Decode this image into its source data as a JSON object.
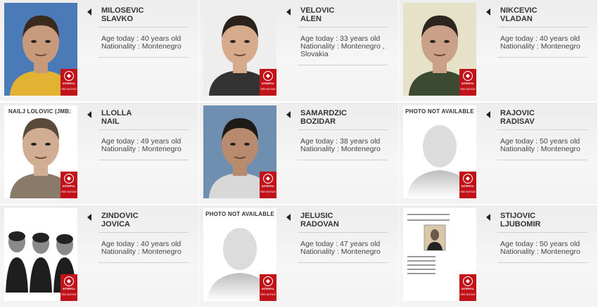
{
  "age_prefix": "Age today : ",
  "nationality_prefix": "Nationality : ",
  "notice_badge": {
    "brand": "INTERPOL",
    "kind": "RED NOTICE",
    "color": "#c1121a"
  },
  "placeholder_caption": "PHOTO NOT AVAILABLE",
  "persons": [
    {
      "surname": "MILOSEVIC",
      "forename": "SLAVKO",
      "age": "40 years old",
      "nationality": "Montenegro",
      "photo": "photo",
      "photo_text": ""
    },
    {
      "surname": "VELOVIC",
      "forename": "ALEN",
      "age": "33 years old",
      "nationality": "Montenegro , Slovakia",
      "photo": "photo",
      "photo_text": ""
    },
    {
      "surname": "NIKCEVIC",
      "forename": "VLADAN",
      "age": "40 years old",
      "nationality": "Montenegro",
      "photo": "photo",
      "photo_text": ""
    },
    {
      "surname": "LLOLLA",
      "forename": "NAIL",
      "age": "49 years old",
      "nationality": "Montenegro",
      "photo": "photo",
      "photo_text": "NAILJ LOLOVIC (JMB:"
    },
    {
      "surname": "SAMARDZIC",
      "forename": "BOZIDAR",
      "age": "38 years old",
      "nationality": "Montenegro",
      "photo": "photo",
      "photo_text": ""
    },
    {
      "surname": "RAJOVIC",
      "forename": "RADISAV",
      "age": "50 years old",
      "nationality": "Montenegro",
      "photo": "placeholder",
      "photo_text": ""
    },
    {
      "surname": "ZINDOVIC",
      "forename": "JOVICA",
      "age": "40 years old",
      "nationality": "Montenegro",
      "photo": "photo",
      "photo_text": ""
    },
    {
      "surname": "JELUSIC",
      "forename": "RADOVAN",
      "age": "47 years old",
      "nationality": "Montenegro",
      "photo": "placeholder",
      "photo_text": ""
    },
    {
      "surname": "STIJOVIC",
      "forename": "LJUBOMIR",
      "age": "50 years old",
      "nationality": "Montenegro",
      "photo": "document",
      "photo_text": ""
    }
  ]
}
